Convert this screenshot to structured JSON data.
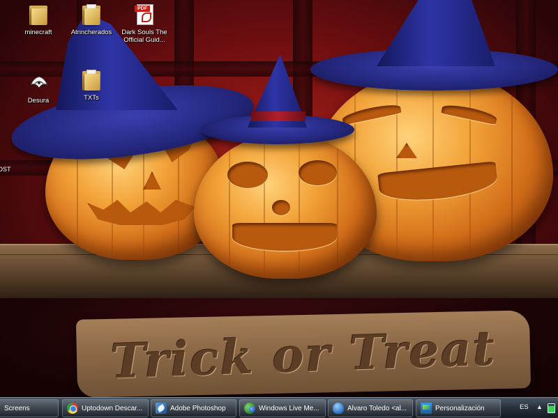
{
  "desktop": {
    "icons": [
      {
        "label": "minecraft",
        "icon": "folder-icon"
      },
      {
        "label": "Atrincherados",
        "icon": "folder-icon"
      },
      {
        "label": "Dark Souls The Official Guid...",
        "icon": "pdf-file-icon"
      },
      {
        "label": "Desura",
        "icon": "desura-icon"
      },
      {
        "label": "TXTs",
        "icon": "folder-icon"
      }
    ],
    "edge_fragment": "OST"
  },
  "wallpaper": {
    "sign_text": "Trick or Treat",
    "pumpkin_color": "#f3a43a",
    "hat_color": "#2e34a6",
    "background_color": "#6e0e10"
  },
  "taskbar": {
    "buttons": [
      {
        "label": "Screens",
        "icon": "none"
      },
      {
        "label": "Uptodown Descar...",
        "icon": "chrome-icon"
      },
      {
        "label": "Adobe Photoshop",
        "icon": "photoshop-icon"
      },
      {
        "label": "Windows Live Me...",
        "icon": "windows-live-messenger-icon"
      },
      {
        "label": "Alvaro Toledo <al...",
        "icon": "messenger-contact-icon"
      },
      {
        "label": "Personalización",
        "icon": "personalization-icon"
      }
    ],
    "tray": {
      "language": "ES",
      "chevron": "▲",
      "battery_icon": "battery-icon"
    }
  }
}
